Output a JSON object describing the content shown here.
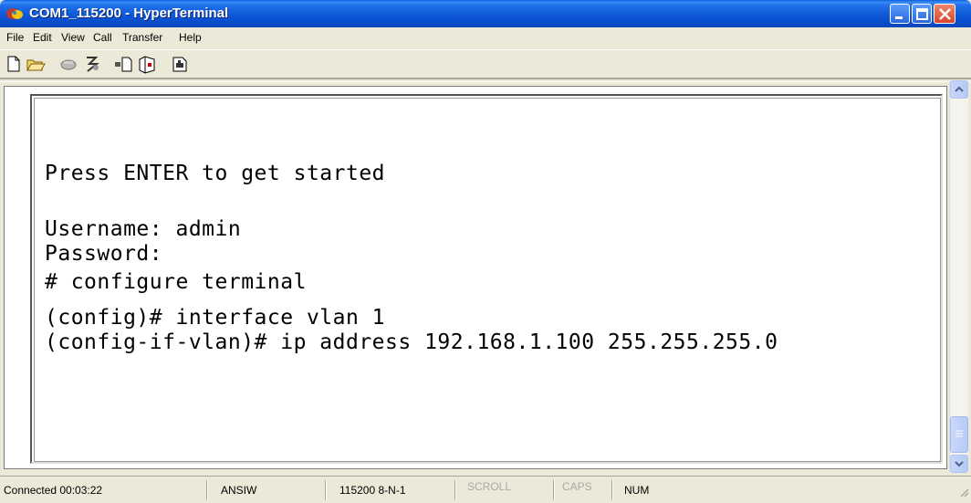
{
  "window": {
    "title": "COM1_115200 - HyperTerminal"
  },
  "menu": [
    {
      "label": "File"
    },
    {
      "label": "Edit"
    },
    {
      "label": "View"
    },
    {
      "label": "Call"
    },
    {
      "label": "Transfer"
    },
    {
      "label": "Help"
    }
  ],
  "toolbar": [
    {
      "icon": "new-document-icon"
    },
    {
      "icon": "open-folder-icon"
    },
    {
      "icon": "call-icon"
    },
    {
      "icon": "disconnect-icon"
    },
    {
      "icon": "send-file-icon"
    },
    {
      "icon": "receive-file-icon"
    },
    {
      "icon": "properties-icon"
    }
  ],
  "terminal": {
    "lines": [
      "Press ENTER to get started",
      "Username: admin",
      "Password:",
      "# configure terminal",
      "(config)# interface vlan 1",
      "(config-if-vlan)# ip address 192.168.1.100 255.255.255.0"
    ]
  },
  "status": {
    "connected": "Connected 00:03:22",
    "emulation": "ANSIW",
    "settings": "115200 8-N-1",
    "scroll": "SCROLL",
    "caps": "CAPS",
    "num": "NUM"
  },
  "colors": {
    "titlebar": "#0C55D6",
    "chrome": "#ECE9D8",
    "terminal_bg": "#FFFFFF"
  }
}
